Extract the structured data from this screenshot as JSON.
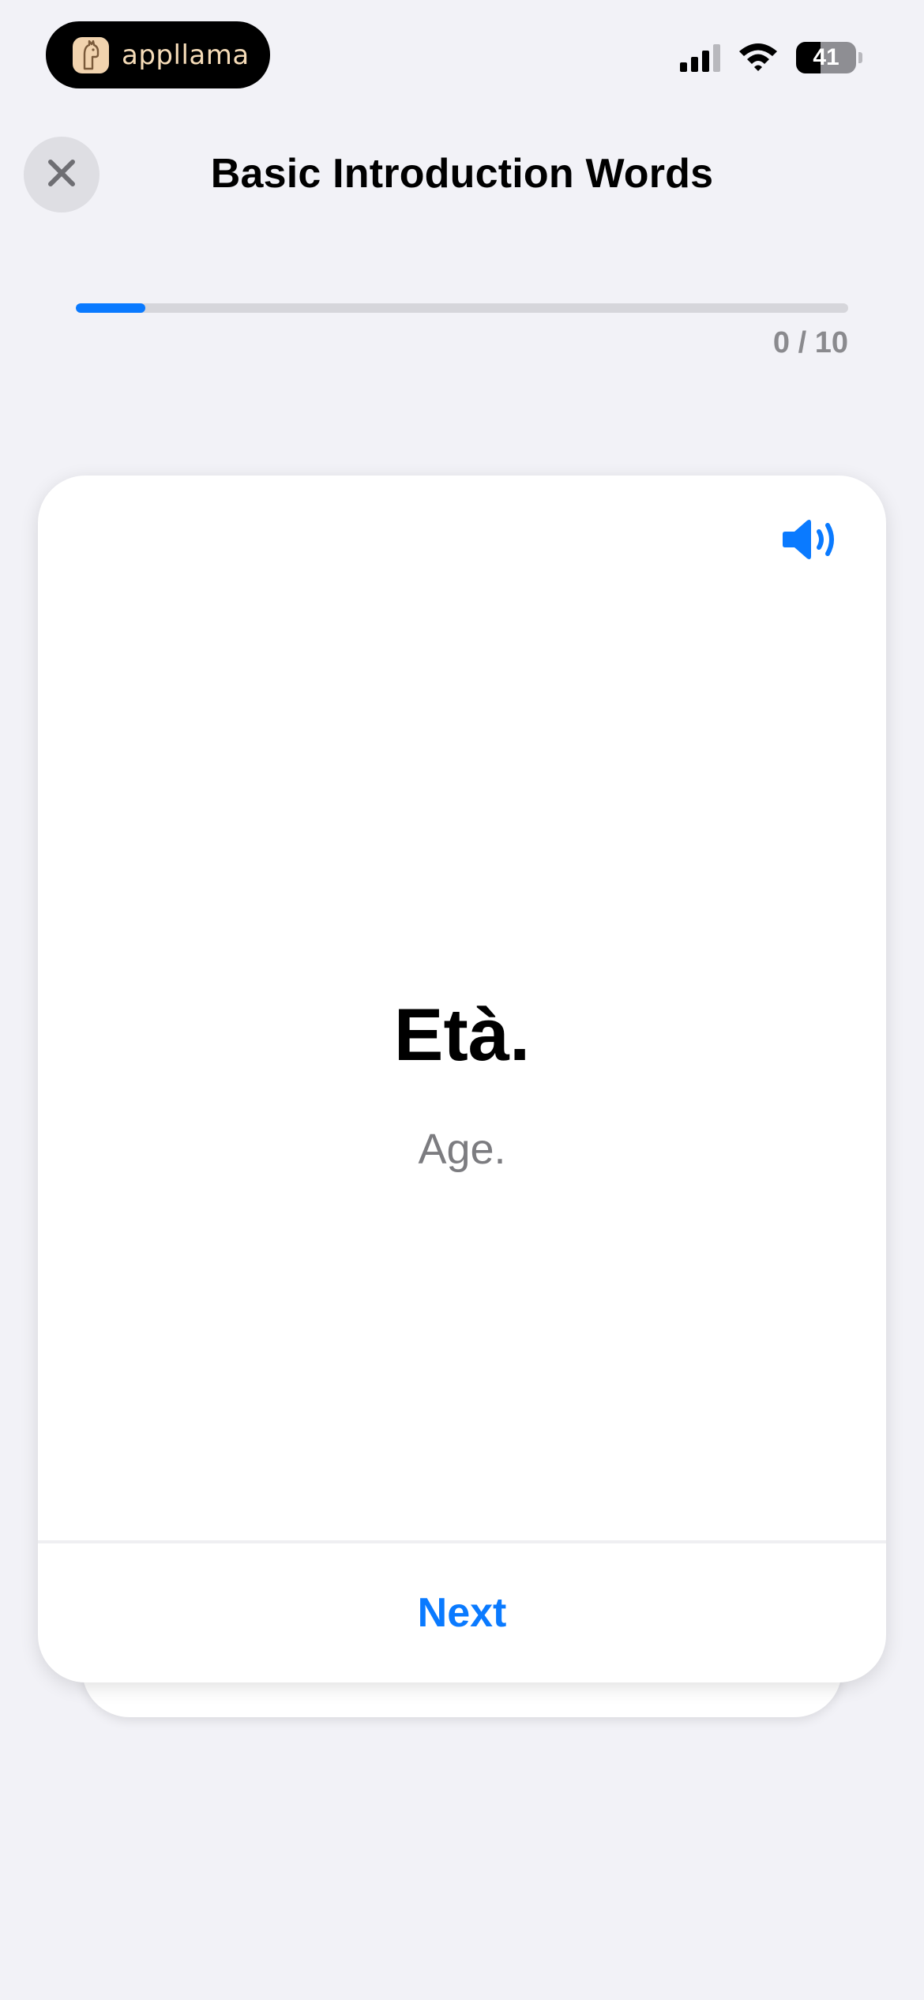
{
  "status_bar": {
    "app_name": "appllama",
    "battery_level": "41",
    "icons": [
      "llama-logo-icon",
      "signal-icon",
      "wifi-icon",
      "battery-icon"
    ]
  },
  "header": {
    "title": "Basic Introduction Words",
    "close_icon": "close-icon"
  },
  "progress": {
    "fraction": 0.09,
    "count_label": "0 / 10",
    "accent_color": "#0a7aff"
  },
  "card": {
    "term": "Età.",
    "translation": "Age.",
    "speaker_icon": "speaker-icon",
    "next_label": "Next"
  },
  "colors": {
    "background": "#f2f2f7",
    "accent": "#0a7aff",
    "secondary_text": "#7c7c80"
  }
}
